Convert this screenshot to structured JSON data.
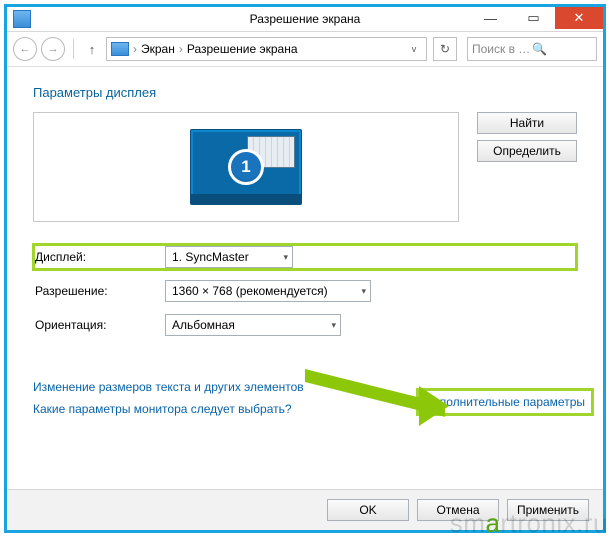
{
  "window": {
    "title": "Разрешение экрана"
  },
  "breadcrumb": {
    "root": "Экран",
    "current": "Разрешение экрана"
  },
  "search": {
    "placeholder": "Поиск в панели у..."
  },
  "heading": "Параметры дисплея",
  "monitor_number": "1",
  "buttons": {
    "find": "Найти",
    "detect": "Определить",
    "ok": "OK",
    "cancel": "Отмена",
    "apply": "Применить"
  },
  "labels": {
    "display": "Дисплей:",
    "resolution": "Разрешение:",
    "orientation": "Ориентация:"
  },
  "values": {
    "display": "1. SyncMaster",
    "resolution": "1360 × 768 (рекомендуется)",
    "orientation": "Альбомная"
  },
  "links": {
    "text_size": "Изменение размеров текста и других элементов",
    "which_monitor": "Какие параметры монитора следует выбрать?",
    "advanced": "Дополнительные параметры"
  },
  "watermark": {
    "p1": "sm",
    "p2": "a",
    "p3": "rtronix.ru"
  }
}
